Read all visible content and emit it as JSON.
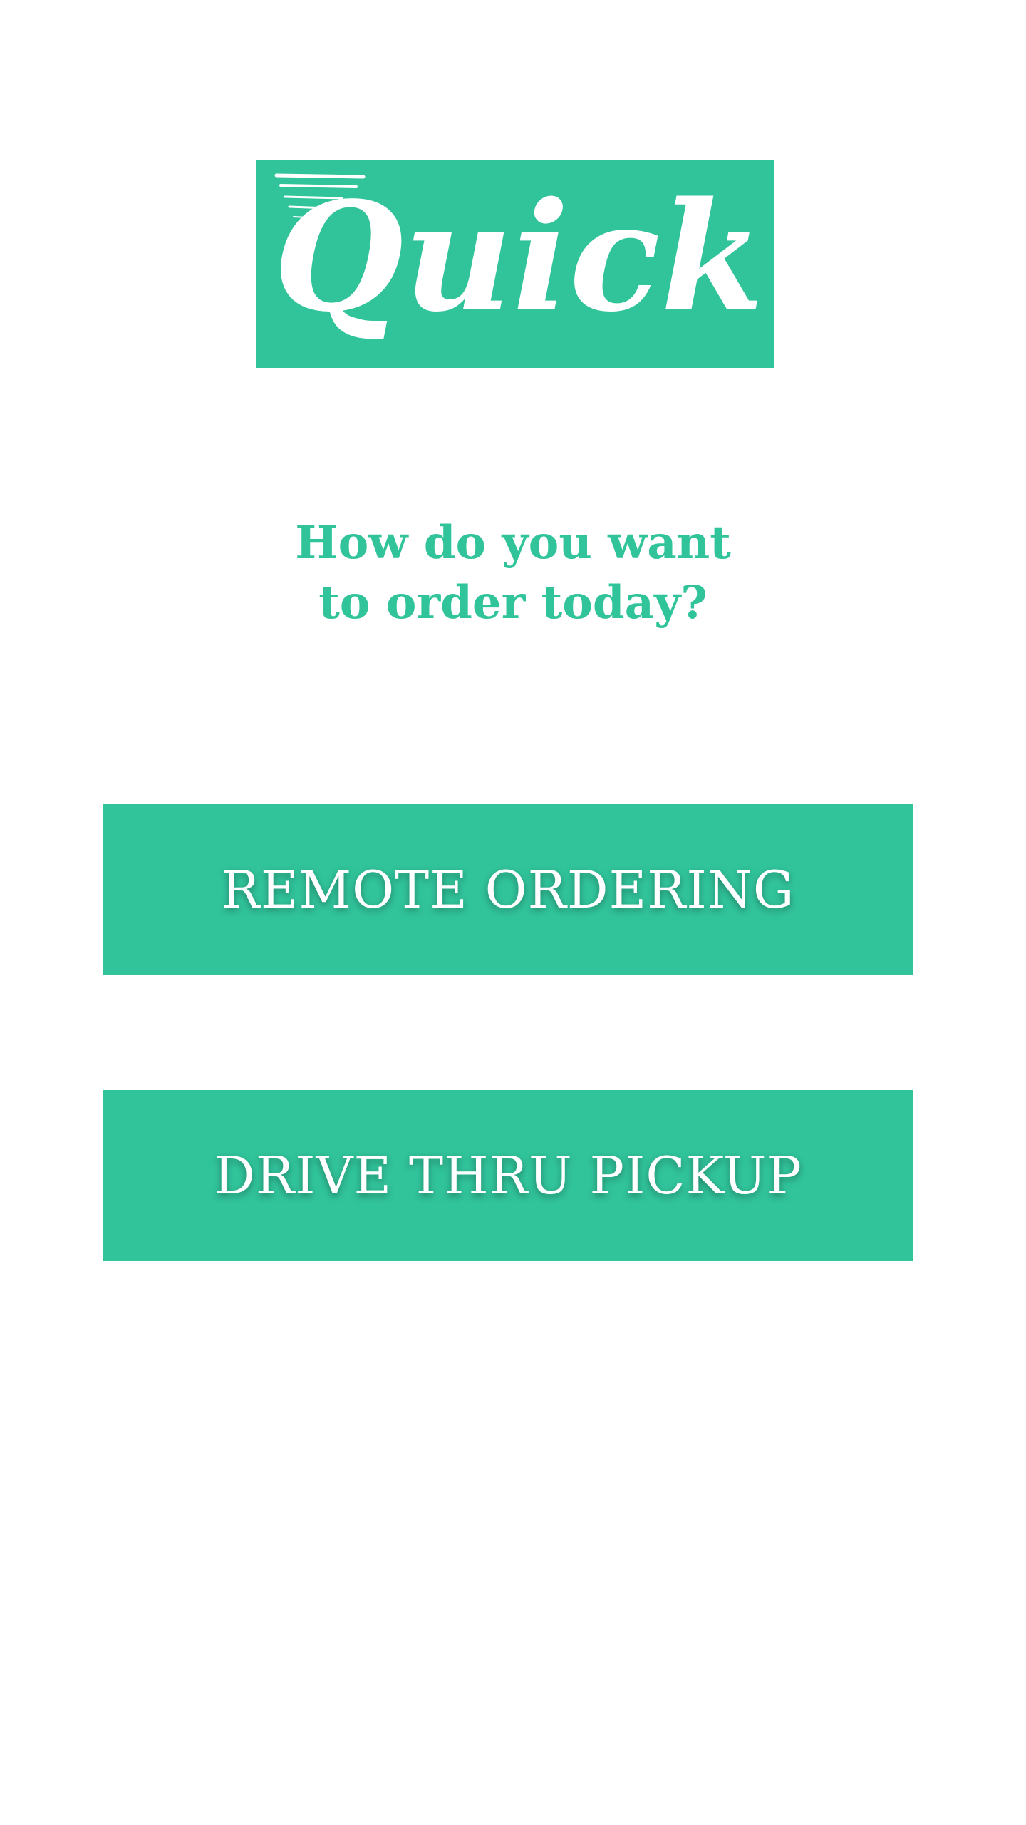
{
  "logo": {
    "text": "Quick",
    "background_color": "#31c49b",
    "text_color": "#ffffff"
  },
  "heading": {
    "line1": "How do you want",
    "line2": "to order today?",
    "color": "#31c49b"
  },
  "buttons": {
    "remote_ordering": "REMOTE ORDERING",
    "drive_thru_pickup": "DRIVE THRU PICKUP"
  },
  "colors": {
    "accent": "#31c49b",
    "button_text": "#ffffff",
    "background": "#ffffff"
  }
}
